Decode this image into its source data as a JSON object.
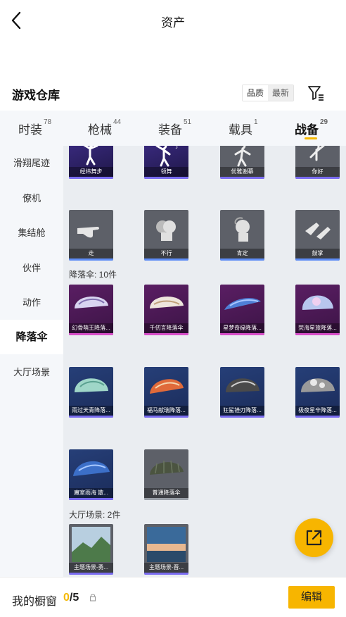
{
  "header": {
    "title": "资产"
  },
  "warehouse": {
    "title": "游戏仓库",
    "sort_options": [
      "品质",
      "最新"
    ]
  },
  "tabs": [
    {
      "label": "时装",
      "count": "78"
    },
    {
      "label": "枪械",
      "count": "44"
    },
    {
      "label": "装备",
      "count": "51"
    },
    {
      "label": "载具",
      "count": "1"
    },
    {
      "label": "战备",
      "count": "29"
    }
  ],
  "sidebar": {
    "items": [
      "滑翔尾迹",
      "僚机",
      "集结舱",
      "伙伴",
      "动作",
      "降落伞",
      "大厅场景"
    ],
    "active": "降落伞"
  },
  "sections": {
    "emotes_row1": [
      "经纬舞步",
      "领舞",
      "优雅谢幕",
      "你好"
    ],
    "emotes_row2": [
      "走",
      "不行",
      "肯定",
      "鼓掌"
    ],
    "parachute_header": "降落伞: 10件",
    "parachutes": [
      "幻骨萌王降落...",
      "千仞言降落伞",
      "星梦奇缘降落...",
      "荧海星旅降落...",
      "雨过天青降落...",
      "福马献瑞降落...",
      "狂鲨锉刃降落...",
      "极夜星辛降落...",
      "魔室雨海 散...",
      "普通降落伞"
    ],
    "lobby_header": "大厅场景: 2件",
    "lobby": [
      "主题场景-勇...",
      "主题场景-晋..."
    ]
  },
  "bottom": {
    "showcase_label": "我的橱窗",
    "showcase_current": "0",
    "showcase_total": "/5",
    "edit_label": "编辑"
  },
  "colors": {
    "accent": "#f7b500",
    "rare_purple": "#7a6cf0",
    "epic_pink": "#d84ec9",
    "common_gray": "#9aa0a8"
  }
}
